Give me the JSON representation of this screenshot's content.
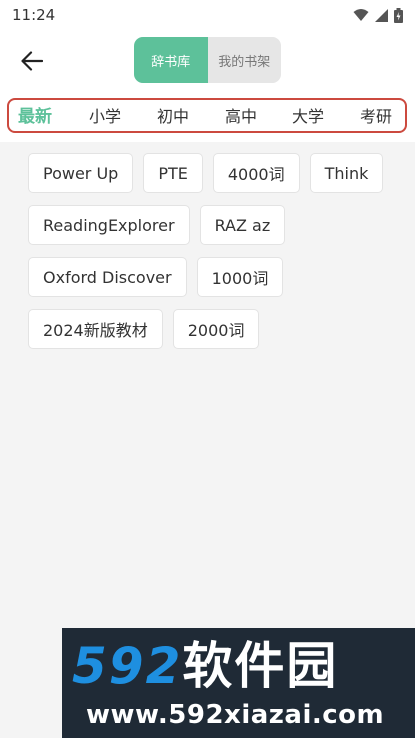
{
  "status": {
    "time": "11:24"
  },
  "header": {
    "tabs": [
      {
        "label": "辞书库",
        "active": true
      },
      {
        "label": "我的书架",
        "active": false
      }
    ]
  },
  "categories": [
    "最新",
    "小学",
    "初中",
    "高中",
    "大学",
    "考研"
  ],
  "tags": [
    [
      "Power Up",
      "PTE",
      "4000词",
      "Think"
    ],
    [
      "ReadingExplorer",
      "RAZ az"
    ],
    [
      "Oxford Discover",
      "1000词"
    ],
    [
      "2024新版教材",
      "2000词"
    ]
  ],
  "watermark": {
    "number": "592",
    "brand": "软件园",
    "url": "www.592xiazai.com"
  },
  "colors": {
    "accent": "#5dc19a",
    "highlight_border": "#cc4a3f"
  }
}
